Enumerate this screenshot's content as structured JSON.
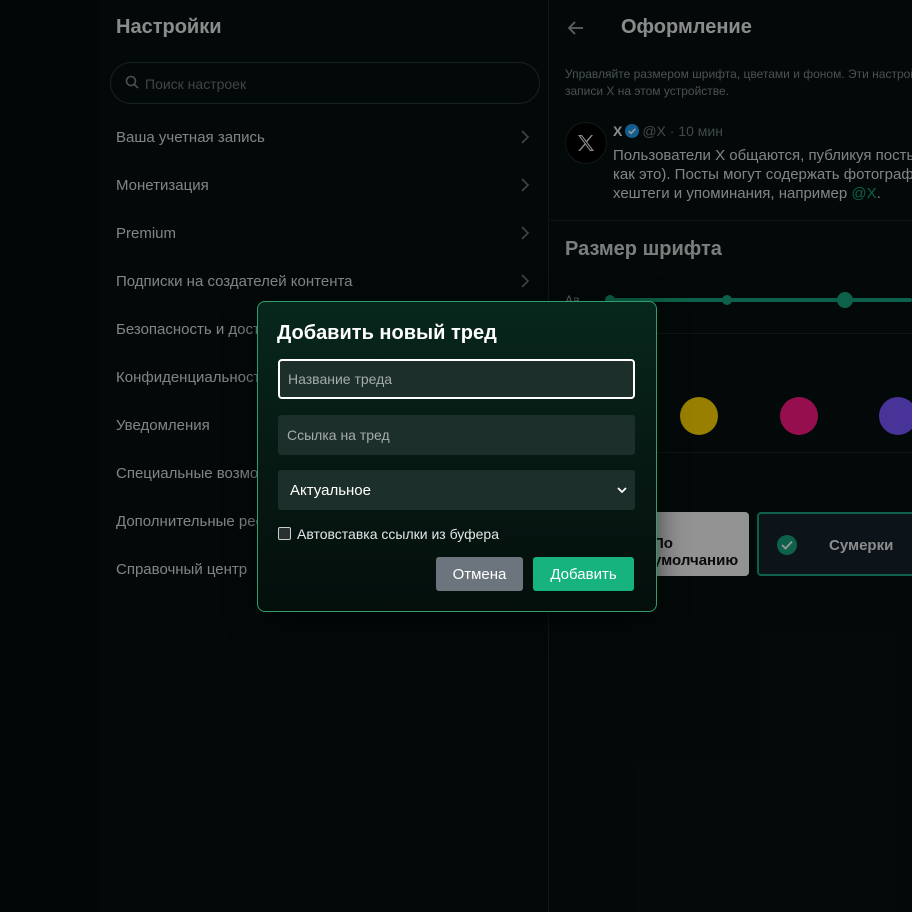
{
  "settings": {
    "title": "Настройки",
    "search_placeholder": "Поиск настроек",
    "items": [
      {
        "label": "Ваша учетная запись"
      },
      {
        "label": "Монетизация"
      },
      {
        "label": "Premium"
      },
      {
        "label": "Подписки на создателей контента"
      },
      {
        "label": "Безопасность и доступ"
      },
      {
        "label": "Конфиденциальность"
      },
      {
        "label": "Уведомления"
      },
      {
        "label": "Специальные возможности"
      },
      {
        "label": "Дополнительные ресурсы"
      },
      {
        "label": "Справочный центр"
      }
    ]
  },
  "appearance": {
    "title": "Оформление",
    "description_lines": [
      "Управляйте размером шрифта, цветами и фоном. Эти настройки",
      "записи X на этом устройстве."
    ],
    "post": {
      "name": "X",
      "handle": "@X",
      "time": "· 10 мин",
      "lines": [
        "Пользователи X общаются, публикуя посты",
        "как это). Посты могут содержать фотографии",
        "хештеги и упоминания, например "
      ],
      "mention": "@X",
      "end": "."
    },
    "font_size_title": "Размер шрифта",
    "font_small_label": "Aa",
    "accent_colors": [
      "#16a07a",
      "#ffd400",
      "#f91880",
      "#7856ff"
    ],
    "backgrounds": {
      "default_label": "По умолчанию",
      "dim_label": "Сумерки"
    }
  },
  "dialog": {
    "title": "Добавить новый тред",
    "name_placeholder": "Название треда",
    "link_placeholder": "Ссылка на тред",
    "select_value": "Актуальное",
    "checkbox_label": "Автовставка ссылки из буфера",
    "checkbox_checked": false,
    "cancel_label": "Отмена",
    "add_label": "Добавить"
  },
  "colors": {
    "accent": "#16a07a",
    "add_button": "#16b37e",
    "cancel_button": "#6c757d",
    "modal_border": "#2f9e6a"
  }
}
